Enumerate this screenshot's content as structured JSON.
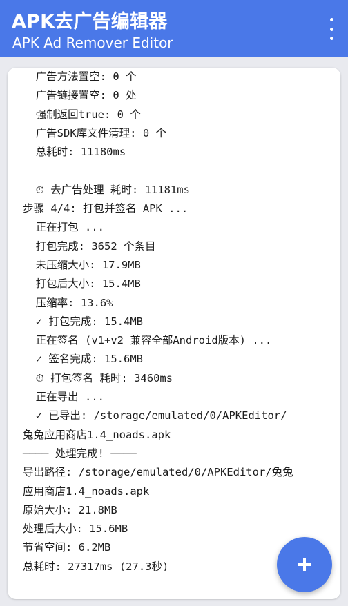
{
  "appbar": {
    "title": "APK去广告编辑器",
    "subtitle": "APK Ad Remover Editor",
    "menu_icon": "more-vert-icon"
  },
  "log": {
    "lines": [
      "  广告方法置空: 0 个",
      "  广告链接置空: 0 处",
      "  强制返回true: 0 个",
      "  广告SDK库文件清理: 0 个",
      "  总耗时: 11180ms",
      "",
      "  ⏱ 去广告处理 耗时: 11181ms",
      "步骤 4/4: 打包并签名 APK ...",
      "  正在打包 ...",
      "  打包完成: 3652 个条目",
      "  未压缩大小: 17.9MB",
      "  打包后大小: 15.4MB",
      "  压缩率: 13.6%",
      "  ✓ 打包完成: 15.4MB",
      "  正在签名 (v1+v2 兼容全部Android版本) ...",
      "  ✓ 签名完成: 15.6MB",
      "  ⏱ 打包签名 耗时: 3460ms",
      "  正在导出 ...",
      "  ✓ 已导出: /storage/emulated/0/APKEditor/",
      "兔兔应用商店1.4_noads.apk",
      "──── 处理完成! ────",
      "导出路径: /storage/emulated/0/APKEditor/兔兔",
      "应用商店1.4_noads.apk",
      "原始大小: 21.8MB",
      "处理后大小: 15.6MB",
      "节省空间: 6.2MB",
      "总耗时: 27317ms (27.3秒)"
    ]
  },
  "fab": {
    "icon": "plus-icon"
  },
  "colors": {
    "primary": "#4a78e8",
    "background": "#e9eaef",
    "card": "#ffffff",
    "text": "#1d1d1d"
  }
}
